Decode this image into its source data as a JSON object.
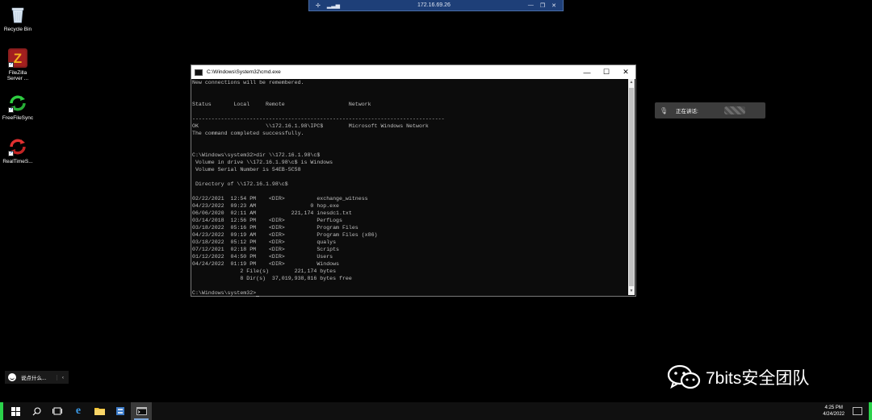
{
  "rdp_bar": {
    "host": "172.16.69.26"
  },
  "desktop": {
    "icons": [
      {
        "label": "Recycle Bin"
      },
      {
        "label": "FileZilla Server ..."
      },
      {
        "label": "FreeFileSync"
      },
      {
        "label": "RealTimeS..."
      }
    ]
  },
  "cmd": {
    "title": "C:\\Windows\\System32\\cmd.exe",
    "lines": [
      "New connections will be remembered.",
      "",
      "",
      "Status       Local     Remote                    Network",
      "",
      "-------------------------------------------------------------------------------",
      "OK                     \\\\172.16.1.98\\IPC$        Microsoft Windows Network",
      "The command completed successfully.",
      "",
      "",
      "C:\\Windows\\system32>dir \\\\172.16.1.98\\c$",
      " Volume in drive \\\\172.16.1.98\\c$ is Windows",
      " Volume Serial Number is 54EB-5C58",
      "",
      " Directory of \\\\172.16.1.98\\c$",
      "",
      "02/22/2021  12:54 PM    <DIR>          exchange_witness",
      "04/23/2022  09:23 AM                 0 hop.exe",
      "06/06/2020  02:11 AM           221,174 inesdc1.txt",
      "03/14/2018  12:56 PM    <DIR>          PerfLogs",
      "03/18/2022  05:16 PM    <DIR>          Program Files",
      "04/23/2022  09:19 AM    <DIR>          Program Files (x86)",
      "03/18/2022  05:12 PM    <DIR>          qualys",
      "07/12/2021  02:18 PM    <DIR>          Scripts",
      "01/12/2022  04:50 PM    <DIR>          Users",
      "04/24/2022  01:19 PM    <DIR>          Windows",
      "               2 File(s)        221,174 bytes",
      "               8 Dir(s)  37,019,938,816 bytes free",
      "",
      "C:\\Windows\\system32>"
    ]
  },
  "voice_widget": {
    "label": "正在讲话:"
  },
  "say_bar": {
    "label": "说点什么..."
  },
  "watermark": {
    "text": "7bits安全团队"
  },
  "clock": {
    "time": "4:25 PM",
    "date": "4/24/2022"
  },
  "colors": {
    "accent_green": "#2bd24b",
    "console_text": "#c0c0c0",
    "rdp_bar": "#1e3f78"
  }
}
